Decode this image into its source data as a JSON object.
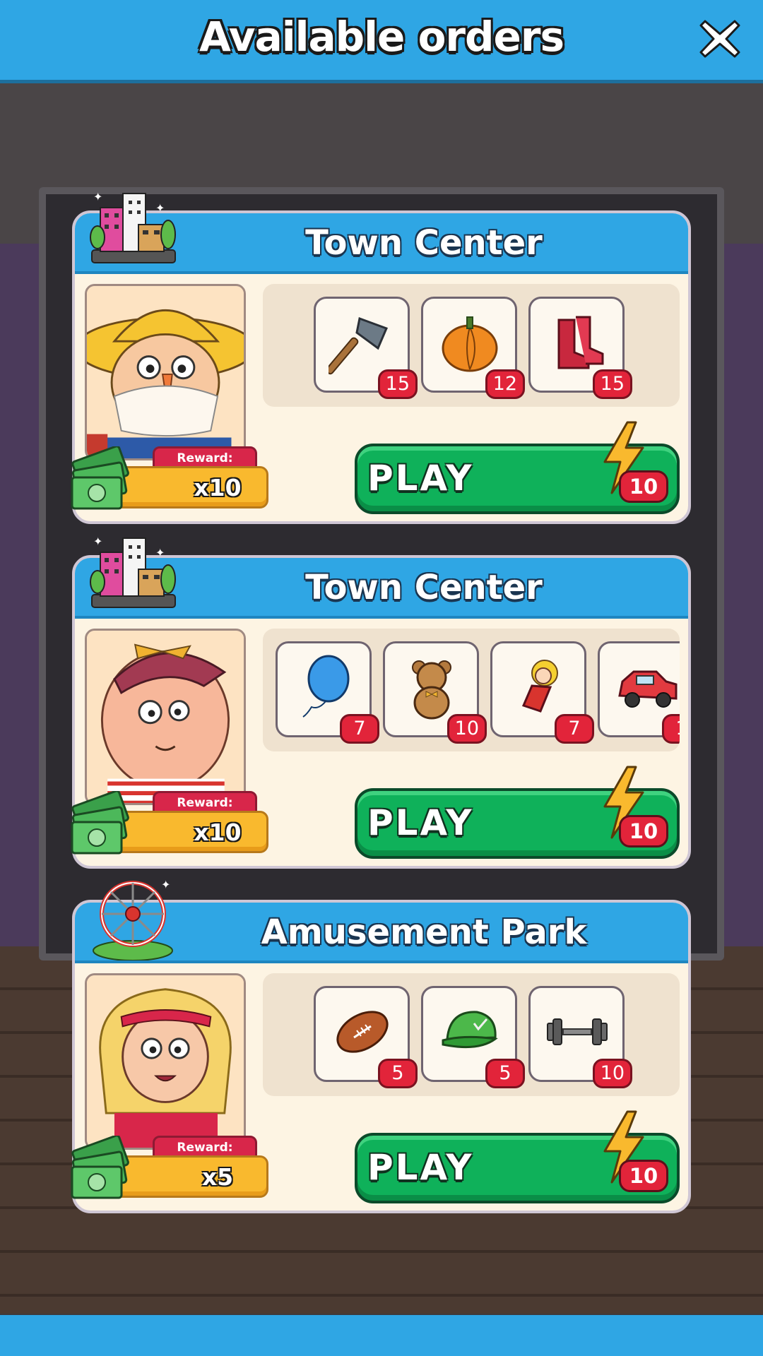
{
  "header": {
    "title": "Available orders",
    "close_icon": "close-x-icon"
  },
  "orders": [
    {
      "location": "Town Center",
      "location_icon": "city-buildings-icon",
      "character": "farmer-portrait",
      "reward_label": "Reward:",
      "reward_value": "x10",
      "reward_icon": "cash-stack-icon",
      "items": [
        {
          "icon": "axe-icon",
          "count": "15"
        },
        {
          "icon": "pumpkin-icon",
          "count": "12"
        },
        {
          "icon": "rubber-boots-icon",
          "count": "15"
        }
      ],
      "play_label": "PLAY",
      "energy_cost": "10",
      "energy_icon": "lightning-bolt-icon"
    },
    {
      "location": "Town Center",
      "location_icon": "city-buildings-icon",
      "character": "boy-portrait",
      "reward_label": "Reward:",
      "reward_value": "x10",
      "reward_icon": "cash-stack-icon",
      "items": [
        {
          "icon": "balloon-icon",
          "count": "7"
        },
        {
          "icon": "teddy-bear-icon",
          "count": "10"
        },
        {
          "icon": "doll-icon",
          "count": "7"
        },
        {
          "icon": "toy-car-icon",
          "count": "1"
        }
      ],
      "play_label": "PLAY",
      "energy_cost": "10",
      "energy_icon": "lightning-bolt-icon"
    },
    {
      "location": "Amusement Park",
      "location_icon": "ferris-wheel-icon",
      "character": "girl-portrait",
      "reward_label": "Reward:",
      "reward_value": "x5",
      "reward_icon": "cash-stack-icon",
      "items": [
        {
          "icon": "football-icon",
          "count": "5"
        },
        {
          "icon": "cap-icon",
          "count": "5"
        },
        {
          "icon": "dumbbell-icon",
          "count": "10"
        }
      ],
      "play_label": "PLAY",
      "energy_cost": "10",
      "energy_icon": "lightning-bolt-icon"
    }
  ],
  "colors": {
    "header_blue": "#2fa6e4",
    "play_green": "#0fb15a",
    "badge_red": "#e2243a",
    "reward_gold": "#f9b92e",
    "card_cream": "#fdf4e3"
  }
}
